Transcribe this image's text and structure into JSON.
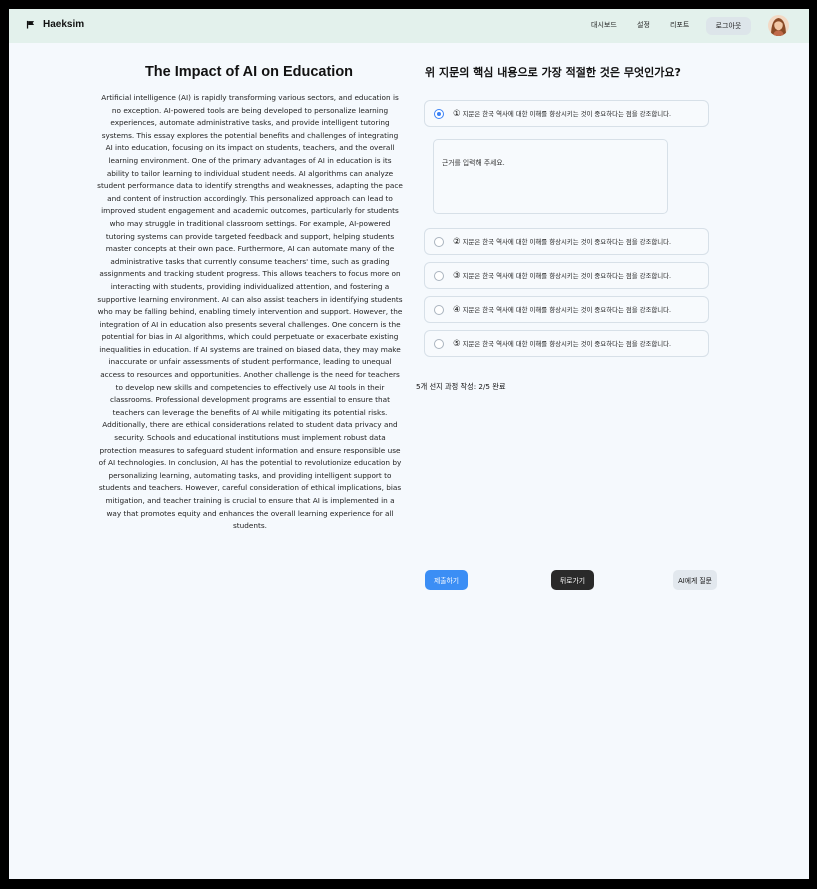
{
  "app": {
    "name": "Haeksim"
  },
  "nav": {
    "items": [
      "대시보드",
      "설정",
      "리포트"
    ],
    "logout_label": "로그아웃"
  },
  "essay": {
    "title": "The Impact of AI on Education",
    "body": "Artificial intelligence (AI) is rapidly transforming various sectors, and education is no exception. AI-powered tools are being developed to personalize learning experiences, automate administrative tasks, and provide intelligent tutoring systems. This essay explores the potential benefits and challenges of integrating AI into education, focusing on its impact on students, teachers, and the overall learning environment. One of the primary advantages of AI in education is its ability to tailor learning to individual student needs. AI algorithms can analyze student performance data to identify strengths and weaknesses, adapting the pace and content of instruction accordingly. This personalized approach can lead to improved student engagement and academic outcomes, particularly for students who may struggle in traditional classroom settings. For example, AI-powered tutoring systems can provide targeted feedback and support, helping students master concepts at their own pace. Furthermore, AI can automate many of the administrative tasks that currently consume teachers' time, such as grading assignments and tracking student progress. This allows teachers to focus more on interacting with students, providing individualized attention, and fostering a supportive learning environment. AI can also assist teachers in identifying students who may be falling behind, enabling timely intervention and support. However, the integration of AI in education also presents several challenges. One concern is the potential for bias in AI algorithms, which could perpetuate or exacerbate existing inequalities in education. If AI systems are trained on biased data, they may make inaccurate or unfair assessments of student performance, leading to unequal access to resources and opportunities. Another challenge is the need for teachers to develop new skills and competencies to effectively use AI tools in their classrooms. Professional development programs are essential to ensure that teachers can leverage the benefits of AI while mitigating its potential risks. Additionally, there are ethical considerations related to student data privacy and security. Schools and educational institutions must implement robust data protection measures to safeguard student information and ensure responsible use of AI technologies. In conclusion, AI has the potential to revolutionize education by personalizing learning, automating tasks, and providing intelligent support to students and teachers. However, careful consideration of ethical implications, bias mitigation, and teacher training is crucial to ensure that AI is implemented in a way that promotes equity and enhances the overall learning experience for all students."
  },
  "question": {
    "text": "위 지문의 핵심 내용으로 가장 적절한 것은 무엇인가요?",
    "options": [
      {
        "num": "①",
        "text": "지문은 한국 역사에 대한 이해를 향상시키는 것이 중요하다는 점을 강조합니다.",
        "selected": true
      },
      {
        "num": "②",
        "text": "지문은 한국 역사에 대한 이해를 향상시키는 것이 중요하다는 점을 강조합니다.",
        "selected": false
      },
      {
        "num": "③",
        "text": "지문은 한국 역사에 대한 이해를 향상시키는 것이 중요하다는 점을 강조합니다.",
        "selected": false
      },
      {
        "num": "④",
        "text": "지문은 한국 역사에 대한 이해를 향상시키는 것이 중요하다는 점을 강조합니다.",
        "selected": false
      },
      {
        "num": "⑤",
        "text": "지문은 한국 역사에 대한 이해를 향상시키는 것이 중요하다는 점을 강조합니다.",
        "selected": false
      }
    ],
    "reason_placeholder": "근거를 입력해 주세요."
  },
  "progress": {
    "text": "5개 선지 과정 작성: 2/5 완료"
  },
  "actions": {
    "submit_label": "제출하기",
    "back_label": "뒤로가기",
    "ai_label": "AI에게 질문"
  },
  "colors": {
    "header_bg": "#e3f1ec",
    "page_bg": "#f5f9fd",
    "accent": "#3b8ef5",
    "dark_button": "#2a2a2a"
  },
  "icons": {
    "logo": "flag-icon",
    "avatar": "user-avatar"
  }
}
